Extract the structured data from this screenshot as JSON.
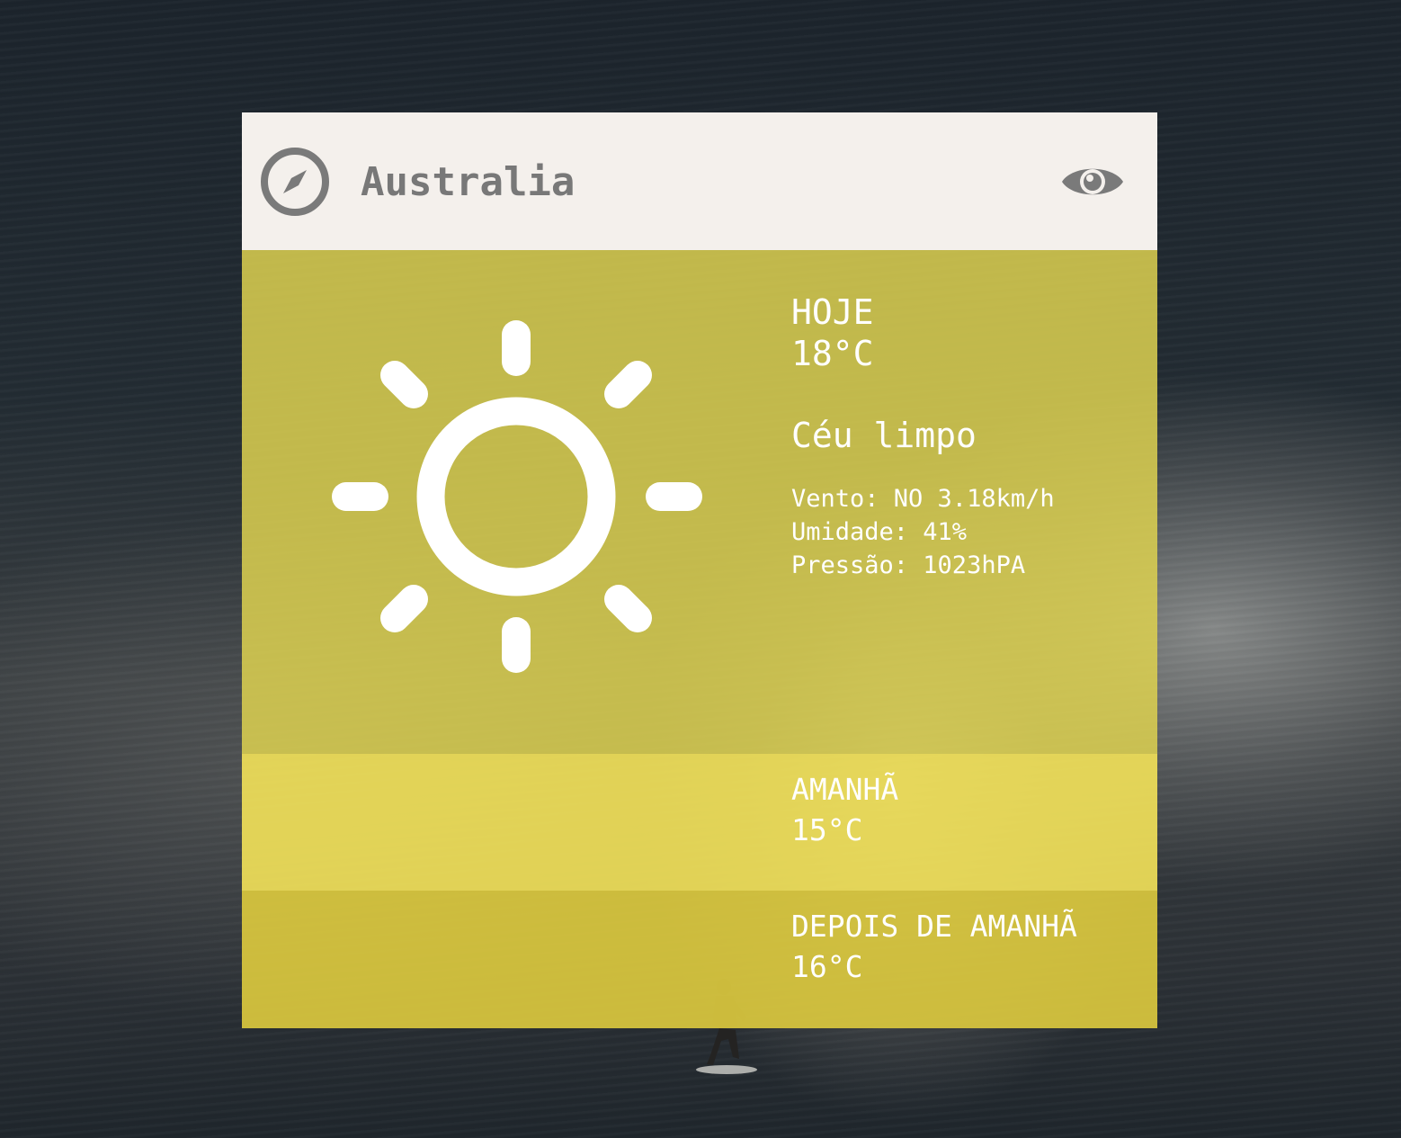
{
  "header": {
    "city": "Australia",
    "location_icon": "compass-icon",
    "view_icon": "eye-icon"
  },
  "today": {
    "label": "HOJE",
    "temperature": "18°C",
    "condition": "Céu limpo",
    "weather_icon": "sun-icon",
    "wind": "Vento: NO 3.18km/h",
    "humidity": "Umidade: 41%",
    "pressure": "Pressão: 1023hPA"
  },
  "tomorrow": {
    "label": "AMANHÃ",
    "temperature": "15°C"
  },
  "day_after": {
    "label": "DEPOIS DE AMANHÃ",
    "temperature": "16°C"
  },
  "colors": {
    "header_bg": "#f4f0ec",
    "header_text": "#787878",
    "today_bg": "#dcd050",
    "tomorrow_bg": "#eede58",
    "day_after_bg": "#dac83e",
    "text": "#ffffff"
  }
}
